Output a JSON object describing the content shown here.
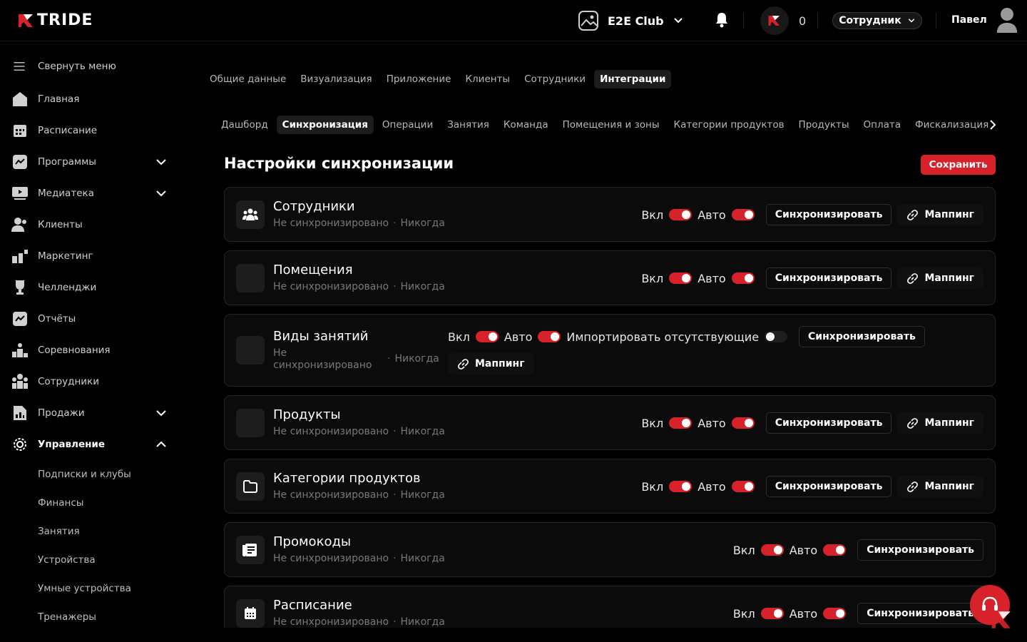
{
  "brand": {
    "logo_text": "TRIDE",
    "accent": "#d7222b"
  },
  "header": {
    "club_name": "E2E Club",
    "points": "0",
    "role": "Сотрудник",
    "user_name": "Павел"
  },
  "sidebar": {
    "collapse_label": "Свернуть меню",
    "items": [
      {
        "label": "Главная",
        "icon": "home-icon"
      },
      {
        "label": "Расписание",
        "icon": "calendar-icon"
      },
      {
        "label": "Программы",
        "icon": "chart-icon",
        "expandable": true
      },
      {
        "label": "Медиатека",
        "icon": "media-icon",
        "expandable": true
      },
      {
        "label": "Клиенты",
        "icon": "clients-icon"
      },
      {
        "label": "Маркетинг",
        "icon": "marketing-icon"
      },
      {
        "label": "Челленджи",
        "icon": "trophy-icon"
      },
      {
        "label": "Отчёты",
        "icon": "reports-icon"
      },
      {
        "label": "Соревнования",
        "icon": "podium-icon"
      },
      {
        "label": "Сотрудники",
        "icon": "staff-icon"
      },
      {
        "label": "Продажи",
        "icon": "sales-icon",
        "expandable": true
      },
      {
        "label": "Управление",
        "icon": "gear-icon",
        "expanded": true,
        "active": true
      }
    ],
    "sub_items": [
      "Подписки и клубы",
      "Финансы",
      "Занятия",
      "Устройства",
      "Умные устройства",
      "Тренажеры"
    ]
  },
  "tabs_main": [
    "Общие данные",
    "Визуализация",
    "Приложение",
    "Клиенты",
    "Сотрудники",
    "Интеграции"
  ],
  "tabs_main_active": 5,
  "tabs_sub": [
    "Дашборд",
    "Синхронизация",
    "Операции",
    "Занятия",
    "Команда",
    "Помещения и зоны",
    "Категории продуктов",
    "Продукты",
    "Оплата",
    "Фискализация"
  ],
  "tabs_sub_active": 1,
  "page": {
    "title": "Настройки синхронизации",
    "save_label": "Сохранить"
  },
  "labels": {
    "on": "Вкл",
    "auto": "Авто",
    "sync": "Синхронизировать",
    "mapping": "Маппинг",
    "import_missing": "Импортировать отсутствующие",
    "status": "Не синхронизировано",
    "last_sync": "Никогда"
  },
  "cards": [
    {
      "title": "Сотрудники",
      "icon": "users-icon",
      "on": true,
      "auto": true,
      "mapping": true
    },
    {
      "title": "Помещения",
      "icon": "blank-icon",
      "on": true,
      "auto": true,
      "mapping": true
    },
    {
      "title": "Виды занятий",
      "icon": "blank-icon",
      "on": true,
      "auto": true,
      "import_missing": false,
      "mapping": true
    },
    {
      "title": "Продукты",
      "icon": "blank-icon",
      "on": true,
      "auto": true,
      "mapping": true
    },
    {
      "title": "Категории продуктов",
      "icon": "folder-icon",
      "on": true,
      "auto": true,
      "mapping": true
    },
    {
      "title": "Промокоды",
      "icon": "promo-icon",
      "on": true,
      "auto": true,
      "mapping": false
    },
    {
      "title": "Расписание",
      "icon": "calendar-icon",
      "on": true,
      "auto": true,
      "mapping": false
    }
  ]
}
